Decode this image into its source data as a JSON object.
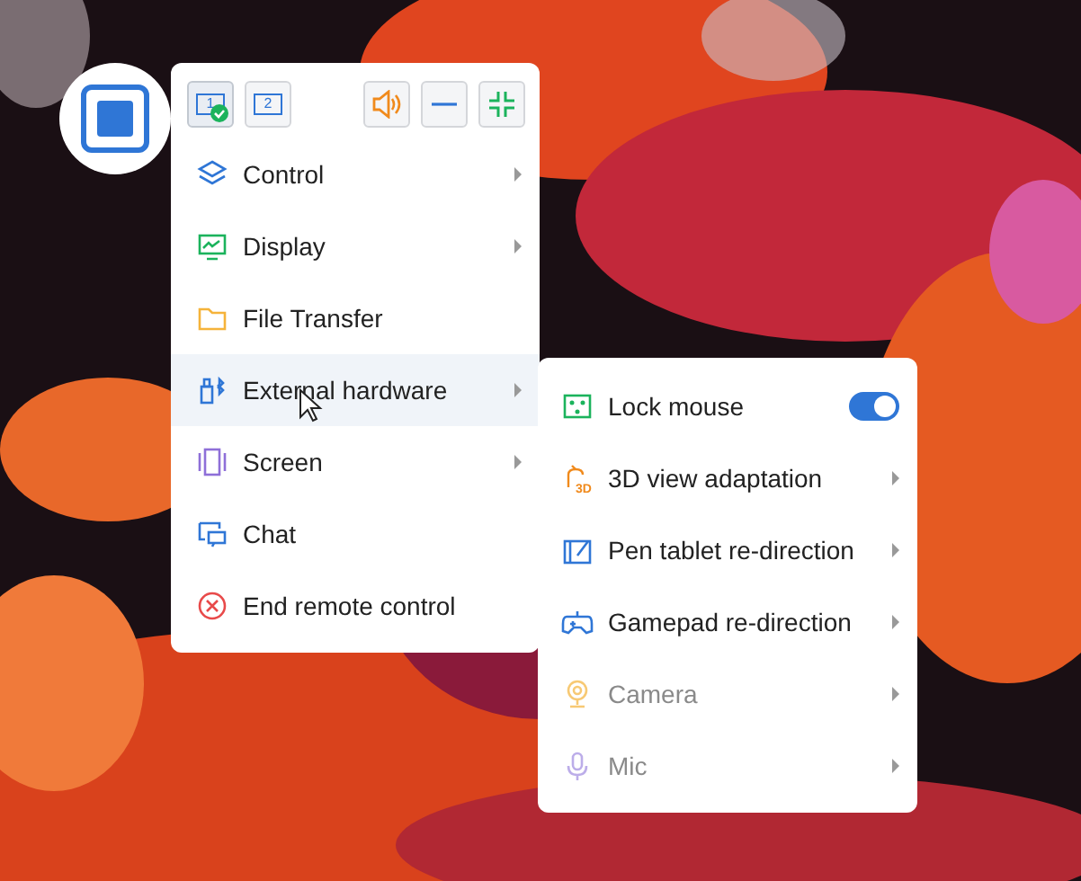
{
  "toolbar": {
    "monitors": [
      {
        "label": "1",
        "selected": true
      },
      {
        "label": "2",
        "selected": false
      }
    ],
    "actions": [
      {
        "kind": "sound"
      },
      {
        "kind": "minimize"
      },
      {
        "kind": "shrink"
      }
    ]
  },
  "menu": {
    "items": [
      {
        "label": "Control",
        "submenu": true,
        "hovered": false
      },
      {
        "label": "Display",
        "submenu": true,
        "hovered": false
      },
      {
        "label": "File Transfer",
        "submenu": false,
        "hovered": false
      },
      {
        "label": "External hardware",
        "submenu": true,
        "hovered": true
      },
      {
        "label": "Screen",
        "submenu": true,
        "hovered": false
      },
      {
        "label": "Chat",
        "submenu": false,
        "hovered": false
      },
      {
        "label": "End remote control",
        "submenu": false,
        "hovered": false
      }
    ]
  },
  "submenu": {
    "items": [
      {
        "label": "Lock mouse",
        "kind": "toggle",
        "on": true,
        "disabled": false
      },
      {
        "label": "3D view adaptation",
        "icon_text": "3D",
        "kind": "submenu",
        "disabled": false
      },
      {
        "label": "Pen tablet re-direction",
        "kind": "submenu",
        "disabled": false
      },
      {
        "label": "Gamepad re-direction",
        "kind": "submenu",
        "disabled": false
      },
      {
        "label": "Camera",
        "kind": "submenu",
        "disabled": true
      },
      {
        "label": "Mic",
        "kind": "submenu",
        "disabled": true
      }
    ]
  }
}
